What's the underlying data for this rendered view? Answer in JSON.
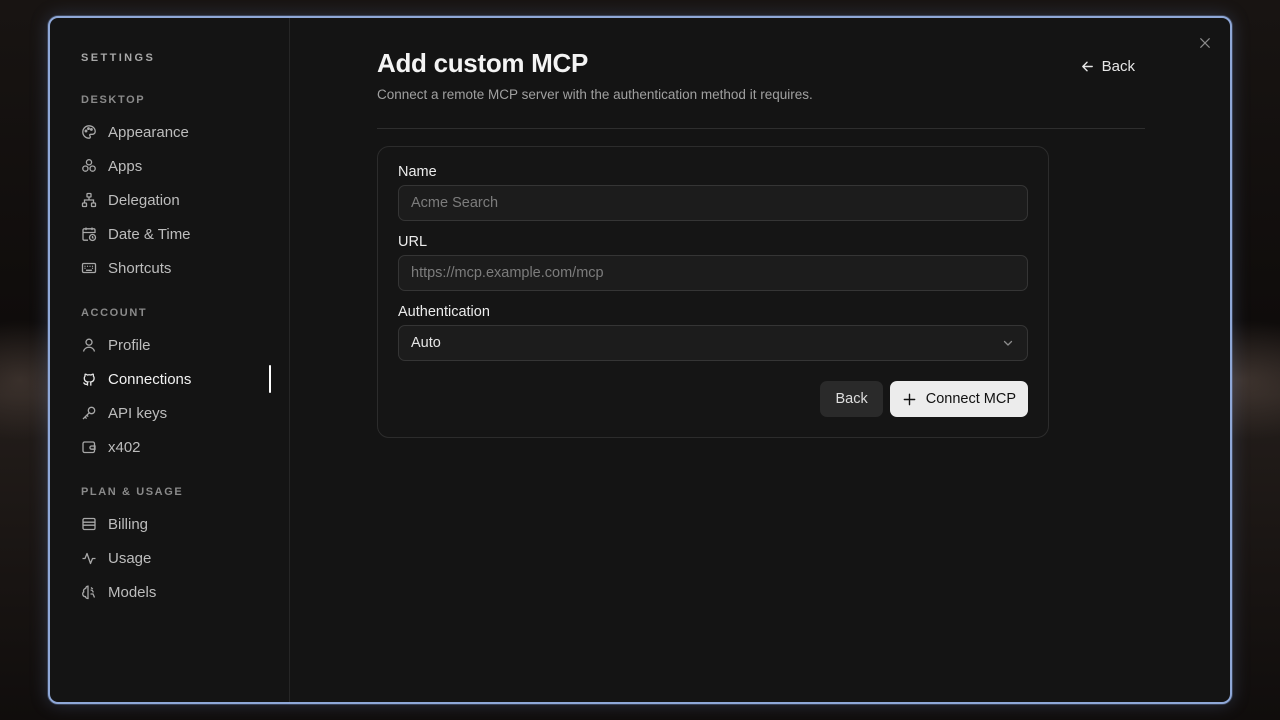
{
  "sidebar": {
    "title": "SETTINGS",
    "sections": [
      {
        "label": "DESKTOP",
        "items": [
          {
            "label": "Appearance",
            "icon": "palette-icon"
          },
          {
            "label": "Apps",
            "icon": "apps-icon"
          },
          {
            "label": "Delegation",
            "icon": "hierarchy-icon"
          },
          {
            "label": "Date & Time",
            "icon": "calendar-clock-icon"
          },
          {
            "label": "Shortcuts",
            "icon": "keyboard-icon"
          }
        ]
      },
      {
        "label": "ACCOUNT",
        "items": [
          {
            "label": "Profile",
            "icon": "user-icon"
          },
          {
            "label": "Connections",
            "icon": "github-icon",
            "active": true
          },
          {
            "label": "API keys",
            "icon": "key-icon"
          },
          {
            "label": "x402",
            "icon": "wallet-icon"
          }
        ]
      },
      {
        "label": "PLAN & USAGE",
        "items": [
          {
            "label": "Billing",
            "icon": "billing-icon"
          },
          {
            "label": "Usage",
            "icon": "activity-icon"
          },
          {
            "label": "Models",
            "icon": "brain-icon"
          }
        ]
      }
    ]
  },
  "header": {
    "title": "Add custom MCP",
    "subtitle": "Connect a remote MCP server with the authentication method it requires.",
    "back_label": "Back"
  },
  "form": {
    "name_label": "Name",
    "name_placeholder": "Acme Search",
    "url_label": "URL",
    "url_placeholder": "https://mcp.example.com/mcp",
    "auth_label": "Authentication",
    "auth_value": "Auto",
    "back_button": "Back",
    "connect_button": "Connect MCP"
  },
  "colors": {
    "accent_border": "#8fa8d8",
    "primary_button": "#ececec"
  }
}
